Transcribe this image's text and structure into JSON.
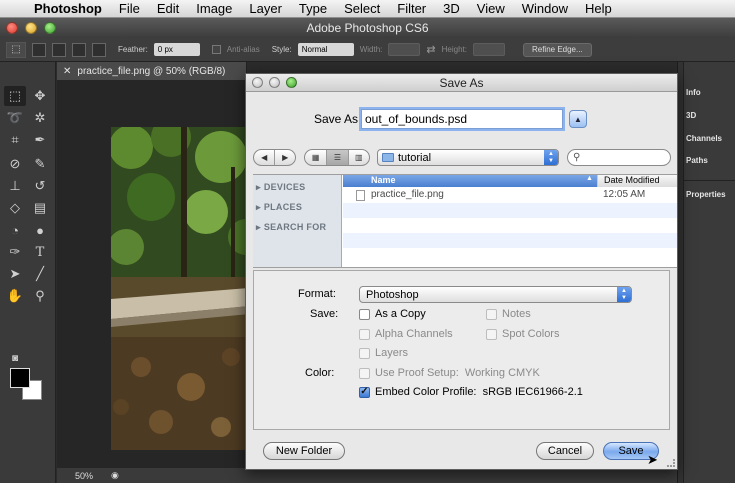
{
  "menubar": {
    "apple": "",
    "items": [
      "Photoshop",
      "File",
      "Edit",
      "Image",
      "Layer",
      "Type",
      "Select",
      "Filter",
      "3D",
      "View",
      "Window",
      "Help"
    ]
  },
  "app": {
    "title": "Adobe Photoshop CS6"
  },
  "options_bar": {
    "feather_label": "Feather:",
    "feather_value": "0 px",
    "antialias_label": "Anti-alias",
    "style_label": "Style:",
    "style_value": "Normal",
    "width_label": "Width:",
    "height_label": "Height:",
    "refine_edge": "Refine Edge..."
  },
  "document": {
    "tab_title": "practice_file.png @ 50% (RGB/8)",
    "zoom": "50%"
  },
  "right_panel": {
    "items": [
      "Info",
      "3D",
      "Channels",
      "Paths",
      "Properties"
    ]
  },
  "tools": [
    "marquee",
    "move",
    "lasso",
    "magic-wand",
    "crop",
    "eyedropper",
    "spot-heal",
    "brush",
    "clone-stamp",
    "history-brush",
    "eraser",
    "gradient",
    "blur",
    "dodge",
    "pen",
    "type",
    "path-select",
    "line",
    "hand",
    "zoom"
  ],
  "dialog": {
    "title": "Save As",
    "save_as_label": "Save As:",
    "filename": "out_of_bounds.psd",
    "folder": "tutorial",
    "search_placeholder": "",
    "sidebar": [
      "DEVICES",
      "PLACES",
      "SEARCH FOR"
    ],
    "columns": {
      "name": "Name",
      "date": "Date Modified"
    },
    "files": [
      {
        "name": "practice_file.png",
        "date": "12:05 AM"
      }
    ],
    "format_label": "Format:",
    "format_value": "Photoshop",
    "save_label": "Save:",
    "color_label": "Color:",
    "checkboxes": {
      "as_a_copy": {
        "label": "As a Copy",
        "checked": false,
        "enabled": true
      },
      "notes": {
        "label": "Notes",
        "checked": false,
        "enabled": false
      },
      "alpha_channels": {
        "label": "Alpha Channels",
        "checked": false,
        "enabled": false
      },
      "spot_colors": {
        "label": "Spot Colors",
        "checked": false,
        "enabled": false
      },
      "layers": {
        "label": "Layers",
        "checked": false,
        "enabled": false
      },
      "use_proof_setup": {
        "label": "Use Proof Setup:  Working CMYK",
        "checked": false,
        "enabled": false
      },
      "embed_color_profile": {
        "label": "Embed Color Profile:  sRGB IEC61966-2.1",
        "checked": true,
        "enabled": true
      }
    },
    "new_folder": "New Folder",
    "cancel": "Cancel",
    "save": "Save"
  },
  "colors": {
    "accent": "#3b77d3",
    "ps_background": "#2b2b2b",
    "dialog_background": "#e8e8e8"
  }
}
